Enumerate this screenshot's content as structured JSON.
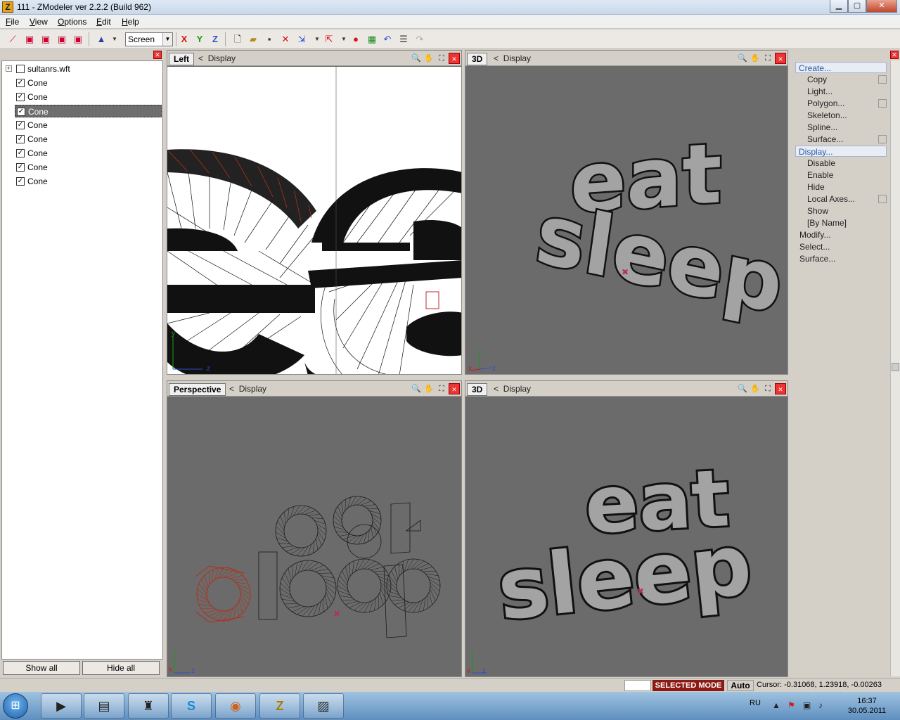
{
  "window": {
    "title": "111 - ZModeler ver 2.2.2 (Build 962)",
    "controls": {
      "minimize": "▁",
      "maximize": "▢",
      "close": "✕"
    }
  },
  "menubar": {
    "items": [
      "File",
      "View",
      "Options",
      "Edit",
      "Help"
    ]
  },
  "toolbar": {
    "screen_select": "Screen",
    "axis_x": "X",
    "axis_y": "Y",
    "axis_z": "Z"
  },
  "tree": {
    "root": "sultanrs.wft",
    "items": [
      {
        "label": "Cone",
        "checked": true,
        "selected": false
      },
      {
        "label": "Cone",
        "checked": true,
        "selected": false
      },
      {
        "label": "Cone",
        "checked": true,
        "selected": true
      },
      {
        "label": "Cone",
        "checked": true,
        "selected": false
      },
      {
        "label": "Cone",
        "checked": true,
        "selected": false
      },
      {
        "label": "Cone",
        "checked": true,
        "selected": false
      },
      {
        "label": "Cone",
        "checked": true,
        "selected": false
      },
      {
        "label": "Cone",
        "checked": true,
        "selected": false
      }
    ],
    "show_all": "Show all",
    "hide_all": "Hide all"
  },
  "viewports": {
    "top_left": {
      "name": "Left",
      "display": "Display",
      "axis_y": "y",
      "axis_z": "z"
    },
    "top_right": {
      "name": "3D",
      "display": "Display",
      "axis_y": "y",
      "axis_x": "x",
      "axis_z": "z"
    },
    "bottom_left": {
      "name": "Perspective",
      "display": "Display",
      "axis_x": "x",
      "axis_z": "z"
    },
    "bottom_right": {
      "name": "3D",
      "display": "Display",
      "axis_x": "x",
      "axis_z": "z"
    }
  },
  "model_text": {
    "line1": "eat",
    "line2": "sleep"
  },
  "commands": {
    "create_header": "Create...",
    "create_items": [
      "Copy",
      "Light...",
      "Polygon...",
      "Skeleton...",
      "Spline...",
      "Surface..."
    ],
    "display_header": "Display...",
    "display_items": [
      "Disable",
      "Enable",
      "Hide",
      "Local Axes...",
      "Show",
      "[By Name]"
    ],
    "tail_items": [
      "Modify...",
      "Select...",
      "Surface..."
    ]
  },
  "status": {
    "mode": "SELECTED MODE",
    "auto": "Auto",
    "cursor": "Cursor: -0.31068, 1.23918, -0.00263"
  },
  "taskbar": {
    "lang": "RU",
    "time": "16:37",
    "date": "30.05.2011"
  },
  "colors": {
    "viewport_bg": "#6b6b6b",
    "status_mode_bg": "#8b1a12",
    "selection_wire": "#b0301a"
  }
}
